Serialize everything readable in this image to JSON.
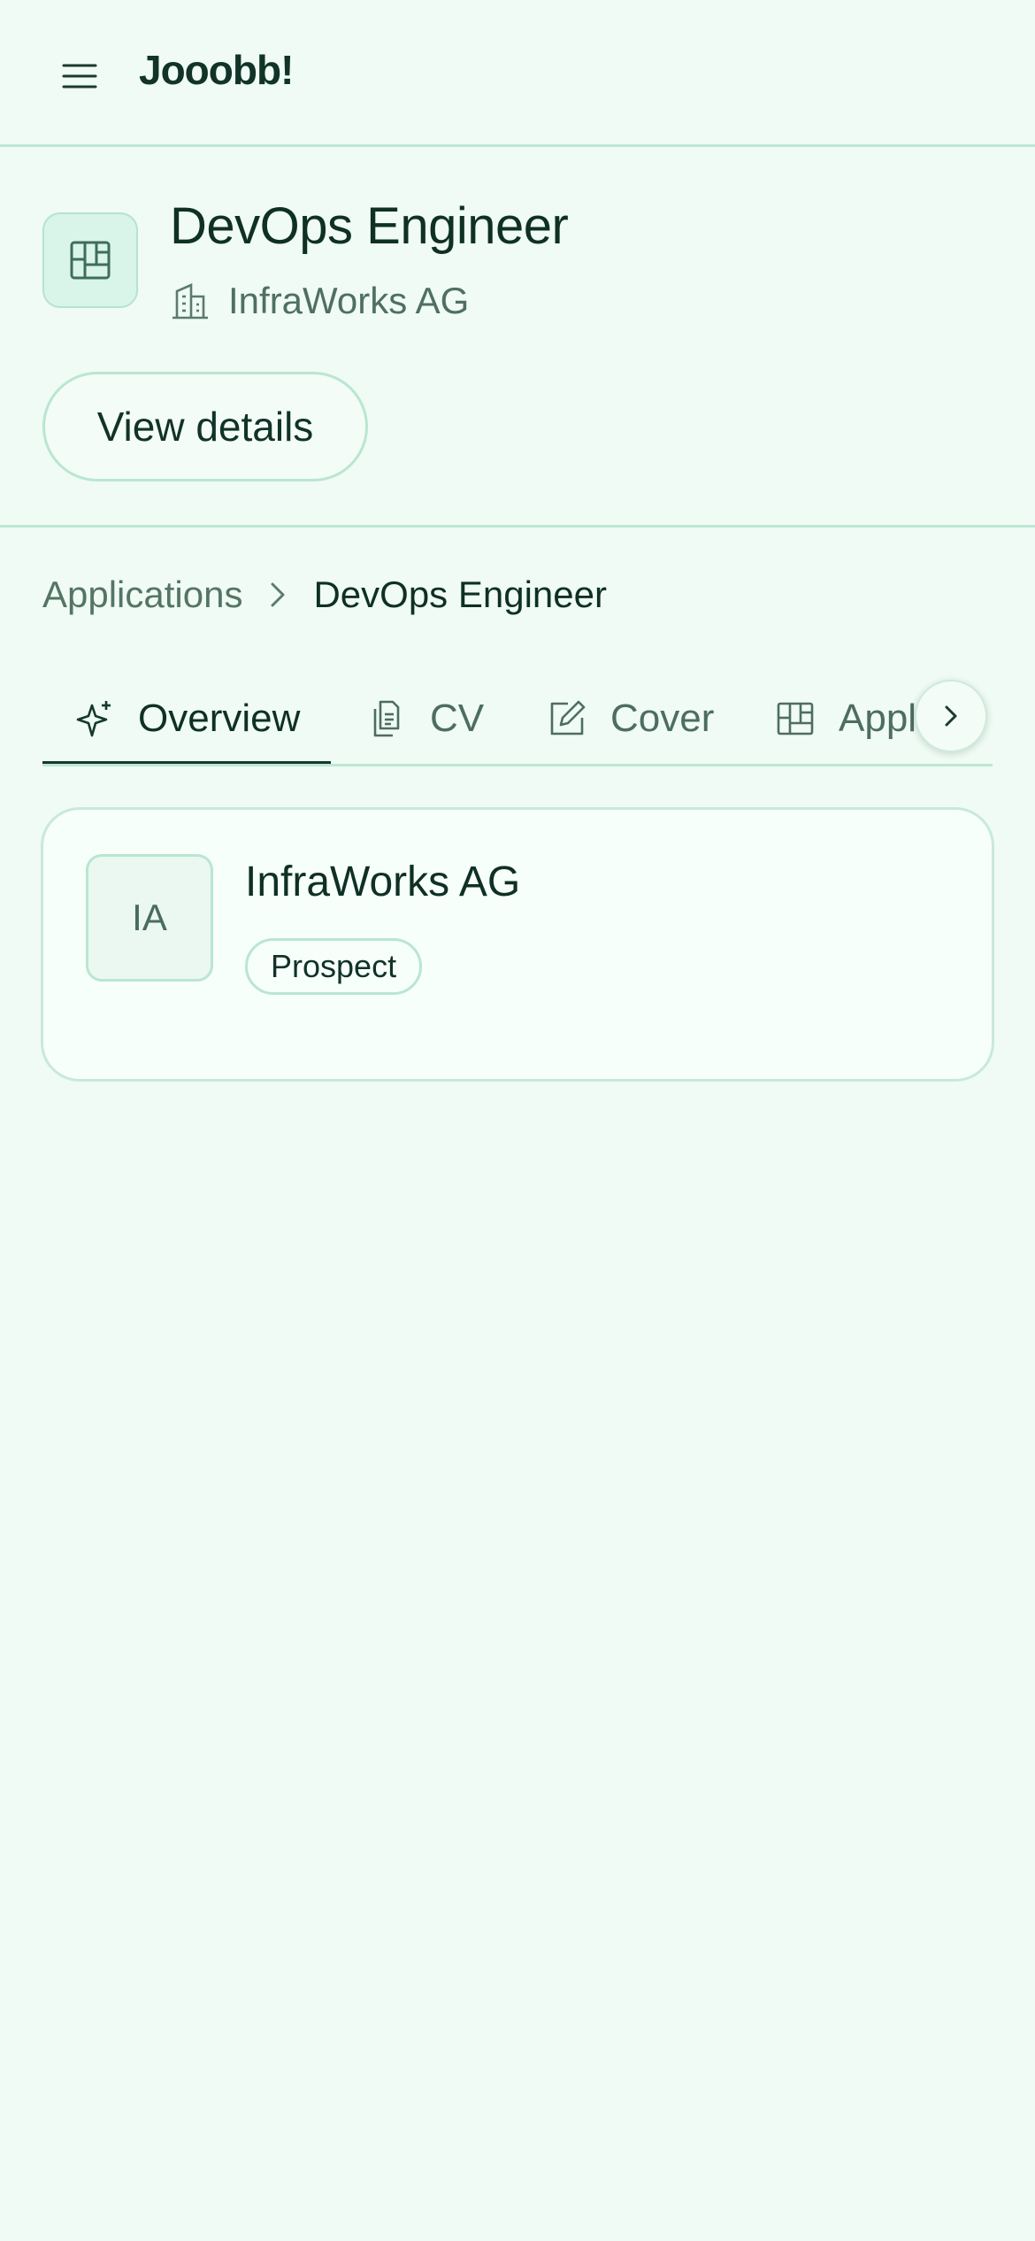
{
  "app": {
    "brand": "Jooobb!"
  },
  "header": {
    "job_title": "DevOps Engineer",
    "company": "InfraWorks AG",
    "details_button": "View details"
  },
  "breadcrumb": {
    "parent": "Applications",
    "current": "DevOps Engineer"
  },
  "tabs": [
    {
      "label": "Overview",
      "icon": "sparkle-icon",
      "active": true
    },
    {
      "label": "CV",
      "icon": "document-icon",
      "active": false
    },
    {
      "label": "Cover",
      "icon": "edit-icon",
      "active": false
    },
    {
      "label": "Appl",
      "icon": "board-icon",
      "active": false
    }
  ],
  "company_card": {
    "initials": "IA",
    "name": "InfraWorks AG",
    "status": "Prospect"
  },
  "colors": {
    "background": "#effbf4",
    "accent": "#143a2d",
    "border": "#bde7d4"
  }
}
